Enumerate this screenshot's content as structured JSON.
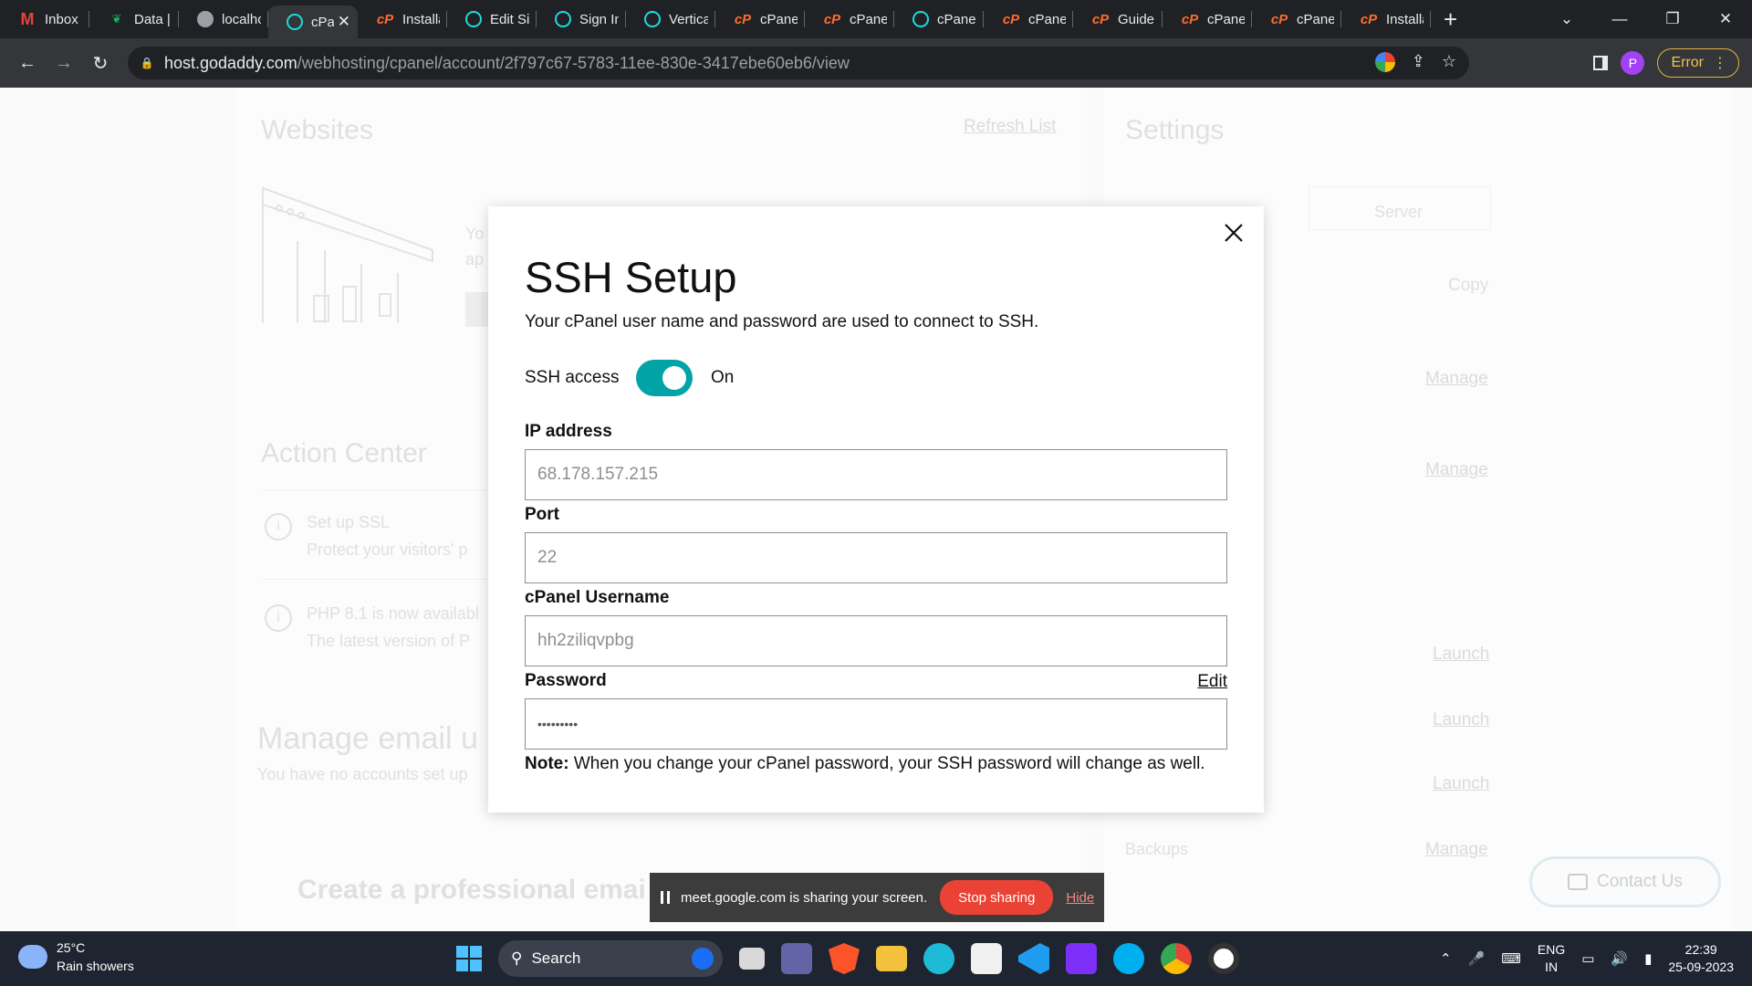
{
  "browser": {
    "tabs": [
      {
        "title": "Inbox (",
        "icon": "gmail-icon",
        "active": false
      },
      {
        "title": "Data | (",
        "icon": "mongodb-leaf-icon",
        "active": false
      },
      {
        "title": "localho",
        "icon": "moon-icon",
        "active": false
      },
      {
        "title": "cPa",
        "icon": "godaddy-icon",
        "active": true
      },
      {
        "title": "Installa",
        "icon": "cpanel-icon",
        "active": false
      },
      {
        "title": "Edit Sit",
        "icon": "godaddy-icon",
        "active": false
      },
      {
        "title": "Sign In",
        "icon": "godaddy-icon",
        "active": false
      },
      {
        "title": "Vertical",
        "icon": "godaddy-icon",
        "active": false
      },
      {
        "title": "cPanel",
        "icon": "cpanel-icon",
        "active": false
      },
      {
        "title": "cPanel |",
        "icon": "cpanel-icon",
        "active": false
      },
      {
        "title": "cPanel",
        "icon": "godaddy-icon",
        "active": false
      },
      {
        "title": "cPanel",
        "icon": "cpanel-icon",
        "active": false
      },
      {
        "title": "Guide t",
        "icon": "cpanel-icon",
        "active": false
      },
      {
        "title": "cPanel",
        "icon": "cpanel-icon",
        "active": false
      },
      {
        "title": "cPanel",
        "icon": "cpanel-icon",
        "active": false
      },
      {
        "title": "Installa",
        "icon": "cpanel-icon",
        "active": false
      }
    ],
    "url_host": "host.godaddy.com",
    "url_path": "/webhosting/cpanel/account/2f797c67-5783-11ee-830e-3417ebe60eb6/view",
    "profile_initial": "P",
    "error_label": "Error"
  },
  "background": {
    "websites_title": "Websites",
    "refresh_list": "Refresh List",
    "settings_title": "Settings",
    "server_label": "Server",
    "copy_label": "Copy",
    "manage_label": "Manage",
    "launch_label": "Launch",
    "backups_label": "Backups",
    "action_center_title": "Action Center",
    "action_items": [
      {
        "title": "Set up SSL",
        "desc": "Protect your visitors' p"
      },
      {
        "title": "PHP 8.1 is now availabl",
        "desc": "The latest version of P"
      }
    ],
    "manage_email_title": "Manage email u",
    "manage_email_desc": "You have no accounts set up",
    "create_email_title": "Create a professional emai",
    "snippet_1": "Yo",
    "snippet_2": "ap",
    "contact_us": "Contact Us"
  },
  "modal": {
    "title": "SSH Setup",
    "description": "Your cPanel user name and password are used to connect to SSH.",
    "ssh_access_label": "SSH access",
    "ssh_access_state": "On",
    "ip_label": "IP address",
    "ip_value": "68.178.157.215",
    "port_label": "Port",
    "port_value": "22",
    "username_label": "cPanel Username",
    "username_value": "hh2ziliqvpbg",
    "password_label": "Password",
    "password_value": "•••••••••",
    "edit_label": "Edit",
    "note_bold": "Note:",
    "note_text": " When you change your cPanel password, your SSH password will change as well."
  },
  "share_bar": {
    "message": "meet.google.com is sharing your screen.",
    "stop_label": "Stop sharing",
    "hide_label": "Hide"
  },
  "taskbar": {
    "temperature": "25°C",
    "weather": "Rain showers",
    "search_label": "Search",
    "language_top": "ENG",
    "language_bottom": "IN",
    "time": "22:39",
    "date": "25-09-2023"
  },
  "colors": {
    "toggle_on": "#00a4a6",
    "stop_sharing": "#ea4335",
    "error_badge": "#f4c34c"
  }
}
